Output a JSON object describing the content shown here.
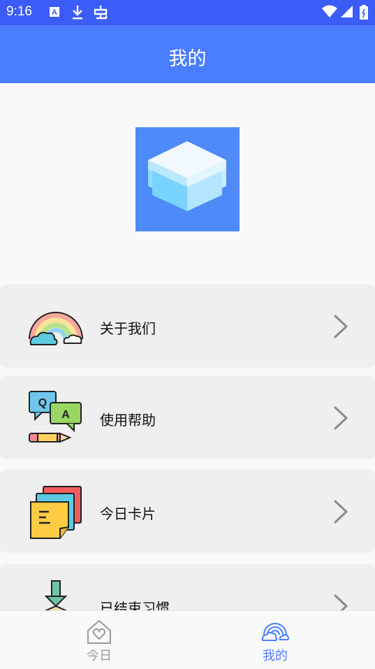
{
  "status_bar": {
    "time": "9:16",
    "icons": [
      "text-a-icon",
      "download-icon",
      "bug-icon",
      "wifi-icon",
      "cell-signal-icon",
      "battery-icon"
    ]
  },
  "app_bar": {
    "title": "我的"
  },
  "logo": {
    "icon": "cube-icon",
    "color": "#4e8af8"
  },
  "menu": {
    "items": [
      {
        "label": "关于我们",
        "icon": "rainbow-icon"
      },
      {
        "label": "使用帮助",
        "icon": "qa-icon"
      },
      {
        "label": "今日卡片",
        "icon": "cards-icon"
      },
      {
        "label": "已结束习惯",
        "icon": "box-icon"
      }
    ]
  },
  "bottom_nav": {
    "tabs": [
      {
        "label": "今日",
        "icon": "home-heart-icon",
        "active": false
      },
      {
        "label": "我的",
        "icon": "rainbow-cloud-icon",
        "active": true
      }
    ],
    "active_color": "#4a7dff",
    "inactive_color": "#9a9a9a"
  },
  "colors": {
    "status_bar": "#3b5cf7",
    "app_bar": "#4a7dff",
    "background": "#f9f9f9",
    "card": "#efefef"
  }
}
